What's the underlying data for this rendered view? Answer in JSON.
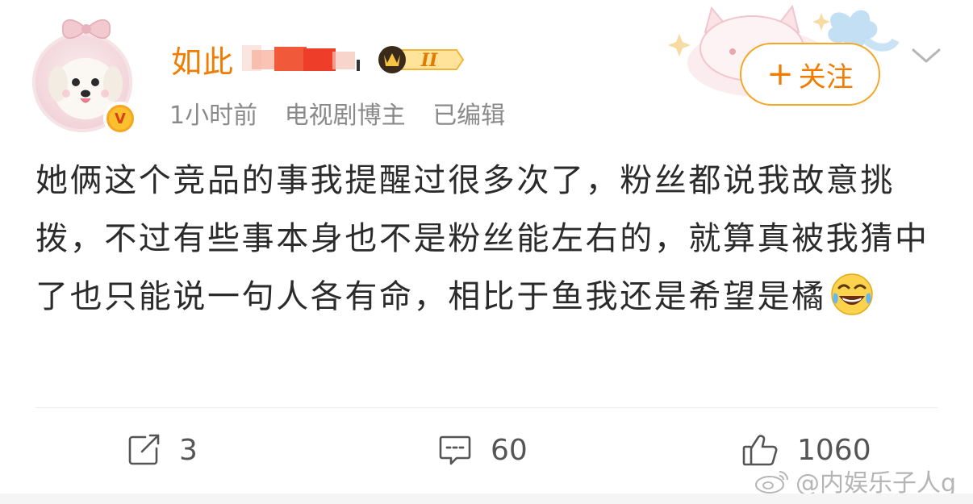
{
  "user": {
    "name": "如此",
    "rank_badge": "II",
    "time": "1小时前",
    "role": "电视剧博主",
    "edited": "已编辑",
    "verified_mark": "V"
  },
  "follow_button": {
    "plus": "+",
    "label": "关注"
  },
  "post": {
    "text": "她俩这个竞品的事我提醒过很多次了，粉丝都说我故意挑拨，不过有些事本身也不是粉丝能左右的，就算真被我猜中了也只能说一句人各有命，相比于鱼我还是希望是橘",
    "emoji": "laughing-tears-emoji"
  },
  "actions": {
    "repost_count": "3",
    "comment_count": "60",
    "like_count": "1060"
  },
  "watermark": {
    "text": "@内娱乐子人g"
  },
  "colors": {
    "name": "#f17c00",
    "accent": "#f5a623",
    "text": "#2b2b2b",
    "meta": "#8a8a8a",
    "action": "#555555"
  }
}
